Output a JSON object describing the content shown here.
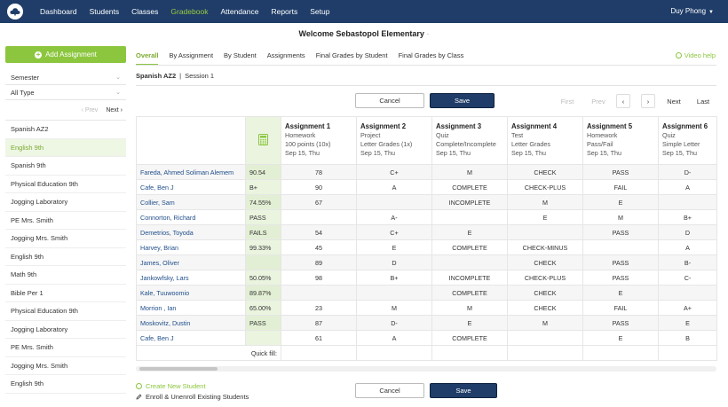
{
  "nav": {
    "items": [
      "Dashboard",
      "Students",
      "Classes",
      "Gradebook",
      "Attendance",
      "Reports",
      "Setup"
    ],
    "active": "Gradebook",
    "user": "Duy Phong"
  },
  "school": {
    "title": "Welcome Sebastopol Elementary",
    "suffix": "·"
  },
  "sidebar": {
    "add_label": "Add Assignment",
    "filter_semester": "Semester",
    "filter_type": "All Type",
    "prev_label": "Prev",
    "next_label": "Next",
    "classes": [
      "Spanish AZ2",
      "English 9th",
      "Spanish 9th",
      "Physical Education 9th",
      "Jogging Laboratory",
      "PE Mrs. Smith",
      "Jogging Mrs. Smith",
      "English 9th",
      "Math 9th",
      "Bible Per 1",
      "Physical Education 9th",
      "Jogging Laboratory",
      "PE Mrs. Smith",
      "Jogging Mrs. Smith",
      "English 9th"
    ],
    "active_index": 1
  },
  "tabs": [
    "Overall",
    "By Assignment",
    "By Student",
    "Assignments",
    "Final Grades by Student",
    "Final Grades by Class"
  ],
  "active_tab": "Overall",
  "video_help": "Video help",
  "section": {
    "class_name": "Spanish AZ2",
    "session": "Session 1"
  },
  "buttons": {
    "cancel": "Cancel",
    "save": "Save"
  },
  "paging": {
    "first": "First",
    "prev": "Prev",
    "prev_arrow": "‹",
    "next_arrow": "›",
    "next": "Next",
    "last": "Last"
  },
  "assignments": [
    {
      "title": "Assignment 1",
      "type": "Homework",
      "scale": "100 points (10x)",
      "date": "Sep 15, Thu"
    },
    {
      "title": "Assignment 2",
      "type": "Project",
      "scale": "Letter Grades (1x)",
      "date": "Sep 15, Thu"
    },
    {
      "title": "Assignment 3",
      "type": "Quiz",
      "scale": "Complete/Incomplete",
      "date": "Sep 15, Thu"
    },
    {
      "title": "Assignment 4",
      "type": "Test",
      "scale": "Letter Grades",
      "date": "Sep 15, Thu"
    },
    {
      "title": "Assignment 5",
      "type": "Homework",
      "scale": "Pass/Fail",
      "date": "Sep 15, Thu"
    },
    {
      "title": "Assignment 6",
      "type": "Quiz",
      "scale": "Simple Letter",
      "date": "Sep 15, Thu"
    }
  ],
  "students": [
    {
      "name": "Fareda, Ahmed Soliman Alemem",
      "avg": "90.54",
      "grades": [
        "78",
        "C+",
        "M",
        "CHECK",
        "PASS",
        "D-"
      ]
    },
    {
      "name": "Cafe, Ben J",
      "avg": "B+",
      "grades": [
        "90",
        "A",
        "COMPLETE",
        "CHECK-PLUS",
        "FAIL",
        "A"
      ]
    },
    {
      "name": "Collier, Sam",
      "avg": "74.55%",
      "grades": [
        "67",
        "",
        "INCOMPLETE",
        "M",
        "E",
        ""
      ]
    },
    {
      "name": "Connorton, Richard",
      "avg": "PASS",
      "grades": [
        "",
        "A-",
        "",
        "E",
        "M",
        "B+"
      ]
    },
    {
      "name": "Demetrios, Toyoda",
      "avg": "FAILS",
      "grades": [
        "54",
        "C+",
        "E",
        "",
        "PASS",
        "D"
      ]
    },
    {
      "name": "Harvey, Brian",
      "avg": "99.33%",
      "grades": [
        "45",
        "E",
        "COMPLETE",
        "CHECK-MINUS",
        "",
        "A"
      ]
    },
    {
      "name": "James, Oliver",
      "avg": "",
      "grades": [
        "89",
        "D",
        "",
        "CHECK",
        "PASS",
        "B-"
      ]
    },
    {
      "name": "Jankowfsky, Lars",
      "avg": "50.05%",
      "grades": [
        "98",
        "B+",
        "INCOMPLETE",
        "CHECK-PLUS",
        "PASS",
        "C-"
      ]
    },
    {
      "name": "Kale, Tuuwoomio",
      "avg": "89.87%",
      "grades": [
        "",
        "",
        "COMPLETE",
        "CHECK",
        "E",
        ""
      ]
    },
    {
      "name": "Morrion , Ian",
      "avg": "65.00%",
      "grades": [
        "23",
        "M",
        "M",
        "CHECK",
        "FAIL",
        "A+"
      ]
    },
    {
      "name": "Moskovitz, Dustin",
      "avg": "PASS",
      "grades": [
        "87",
        "D-",
        "E",
        "M",
        "PASS",
        "E"
      ]
    },
    {
      "name": "Cafe, Ben J",
      "avg": "",
      "grades": [
        "61",
        "A",
        "COMPLETE",
        "",
        "E",
        "B"
      ]
    }
  ],
  "quick_fill": "Quick fill:",
  "footer": {
    "create": "Create New Student",
    "enroll": "Enroll & Unenroll Existing Students"
  }
}
